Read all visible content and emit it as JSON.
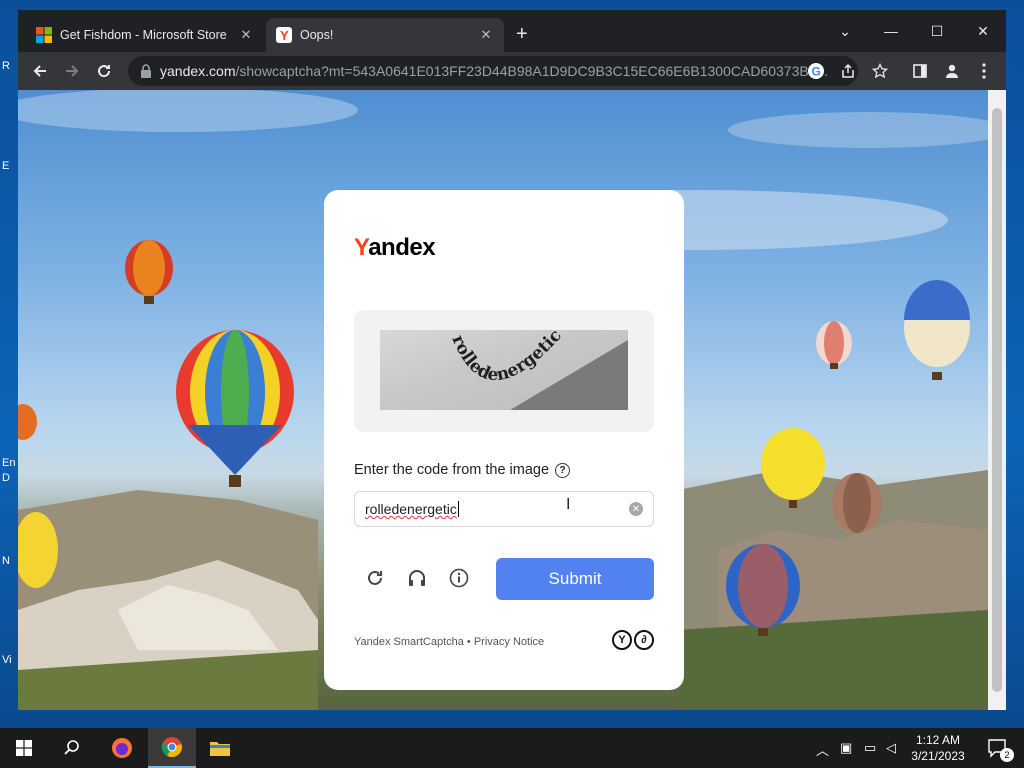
{
  "desktop": {
    "labels": [
      "R",
      "E",
      "En",
      "D",
      "N",
      "Vi"
    ]
  },
  "browser": {
    "tabs": [
      {
        "title": "Get Fishdom - Microsoft Store",
        "icon": "microsoft-logo-icon"
      },
      {
        "title": "Oops!",
        "icon": "yandex-logo-icon"
      }
    ],
    "url_host": "yandex.com",
    "url_path": "/showcaptcha?mt=543A0641E013FF23D44B98A1D9DC9B3C15EC66E6B1300CAD60373B6..."
  },
  "captcha": {
    "logo_first": "Y",
    "logo_rest": "andex",
    "image_text": "rolledenergetic",
    "label": "Enter the code from the image",
    "help_glyph": "?",
    "input_value": "rolledenergetic",
    "submit_label": "Submit",
    "footer_product": "Yandex SmartCaptcha",
    "footer_sep": " • ",
    "footer_privacy": "Privacy Notice",
    "accent": "#5282f0",
    "brand_red": "#fc3f1d"
  },
  "taskbar": {
    "time": "1:12 AM",
    "date": "3/21/2023",
    "notification_count": "2"
  }
}
